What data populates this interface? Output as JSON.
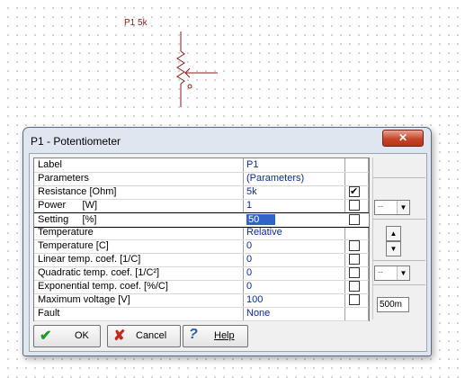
{
  "schematic": {
    "label": "P1 5k"
  },
  "dialog": {
    "title": "P1 - Potentiometer",
    "close_glyph": "✕",
    "properties": [
      {
        "label": "Label",
        "value": "P1",
        "check": null
      },
      {
        "label": "Parameters",
        "value": "(Parameters)",
        "check": null
      },
      {
        "label": "Resistance [Ohm]",
        "value": "5k",
        "check": true
      },
      {
        "label": "Power      [W]",
        "value": "1",
        "check": false
      },
      {
        "label": "Setting     [%]",
        "value": "50",
        "check": false,
        "selected": true
      },
      {
        "label": "Temperature",
        "value": "Relative",
        "check": null
      },
      {
        "label": "Temperature [C]",
        "value": "0",
        "check": false
      },
      {
        "label": "Linear temp. coef. [1/C]",
        "value": "0",
        "check": false
      },
      {
        "label": "Quadratic temp. coef. [1/C²]",
        "value": "0",
        "check": false
      },
      {
        "label": "Exponential temp. coef. [%/C]",
        "value": "0",
        "check": false
      },
      {
        "label": "Maximum voltage [V]",
        "value": "100",
        "check": false
      },
      {
        "label": "Fault",
        "value": "None",
        "check": null
      }
    ],
    "side": {
      "combo1": "--",
      "combo2": "--",
      "spin_up": "▲",
      "spin_down": "▼",
      "step_value": "500m"
    },
    "buttons": {
      "ok": "OK",
      "cancel": "Cancel",
      "help": "Help"
    },
    "icons": {
      "ok": "check-icon",
      "cancel": "x-icon",
      "help": "question-icon"
    },
    "colors": {
      "value_text": "#0a2aa0",
      "selection": "#3064c8",
      "schematic": "#8b1a1a"
    }
  }
}
